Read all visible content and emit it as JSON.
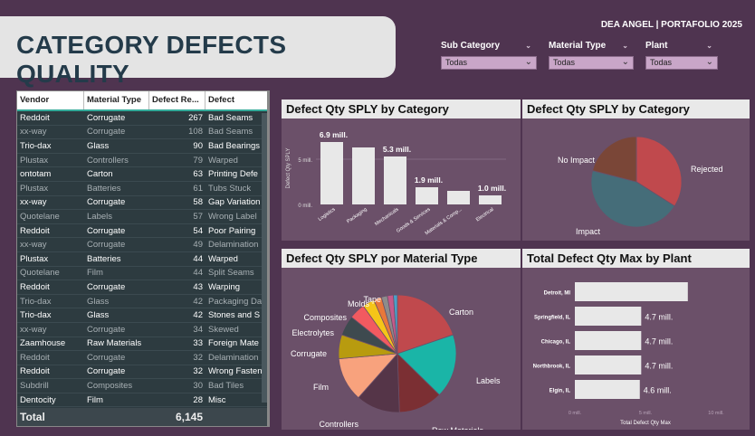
{
  "header": {
    "title": "CATEGORY DEFECTS QUALITY",
    "brand": "DEA ANGEL  |  PORTAFOLIO 2025"
  },
  "slicers": [
    {
      "label": "Sub Category",
      "value": "Todas"
    },
    {
      "label": "Material Type",
      "value": "Todas"
    },
    {
      "label": "Plant",
      "value": "Todas"
    }
  ],
  "table": {
    "columns": [
      "Vendor",
      "Material Type",
      "Defect Re...",
      "Defect"
    ],
    "rows": [
      {
        "vendor": "Reddoit",
        "material": "Corrugate",
        "qty": "267",
        "defect": "Bad Seams",
        "bright": true
      },
      {
        "vendor": "xx-way",
        "material": "Corrugate",
        "qty": "108",
        "defect": "Bad Seams",
        "bright": false
      },
      {
        "vendor": "Trio-dax",
        "material": "Glass",
        "qty": "90",
        "defect": "Bad Bearings",
        "bright": true
      },
      {
        "vendor": "Plustax",
        "material": "Controllers",
        "qty": "79",
        "defect": "Warped",
        "bright": false
      },
      {
        "vendor": "ontotam",
        "material": "Carton",
        "qty": "63",
        "defect": "Printing Defe",
        "bright": true
      },
      {
        "vendor": "Plustax",
        "material": "Batteries",
        "qty": "61",
        "defect": "Tubs Stuck",
        "bright": false
      },
      {
        "vendor": "xx-way",
        "material": "Corrugate",
        "qty": "58",
        "defect": "Gap Variation",
        "bright": true
      },
      {
        "vendor": "Quotelane",
        "material": "Labels",
        "qty": "57",
        "defect": "Wrong Label",
        "bright": false
      },
      {
        "vendor": "Reddoit",
        "material": "Corrugate",
        "qty": "54",
        "defect": "Poor Pairing",
        "bright": true
      },
      {
        "vendor": "xx-way",
        "material": "Corrugate",
        "qty": "49",
        "defect": "Delamination",
        "bright": false
      },
      {
        "vendor": "Plustax",
        "material": "Batteries",
        "qty": "44",
        "defect": "Warped",
        "bright": true
      },
      {
        "vendor": "Quotelane",
        "material": "Film",
        "qty": "44",
        "defect": "Split Seams",
        "bright": false
      },
      {
        "vendor": "Reddoit",
        "material": "Corrugate",
        "qty": "43",
        "defect": "Warping",
        "bright": true
      },
      {
        "vendor": "Trio-dax",
        "material": "Glass",
        "qty": "42",
        "defect": "Packaging Da",
        "bright": false
      },
      {
        "vendor": "Trio-dax",
        "material": "Glass",
        "qty": "42",
        "defect": "Stones and S",
        "bright": true
      },
      {
        "vendor": "xx-way",
        "material": "Corrugate",
        "qty": "34",
        "defect": "Skewed",
        "bright": false
      },
      {
        "vendor": "Zaamhouse",
        "material": "Raw Materials",
        "qty": "33",
        "defect": "Foreign Mate",
        "bright": true
      },
      {
        "vendor": "Reddoit",
        "material": "Corrugate",
        "qty": "32",
        "defect": "Delamination",
        "bright": false
      },
      {
        "vendor": "Reddoit",
        "material": "Corrugate",
        "qty": "32",
        "defect": "Wrong Fasten",
        "bright": true
      },
      {
        "vendor": "Subdrill",
        "material": "Composites",
        "qty": "30",
        "defect": "Bad Tiles",
        "bright": false
      },
      {
        "vendor": "Dentocity",
        "material": "Film",
        "qty": "28",
        "defect": "Misc",
        "bright": true
      }
    ],
    "total_label": "Total",
    "total_value": "6,145"
  },
  "panels": {
    "bar_title": "Defect Qty SPLY by Category",
    "pie1_title": "Defect Qty SPLY by Category",
    "pie2_title": "Defect Qty SPLY por Material Type",
    "hbar_title": "Total Defect Qty Max by Plant"
  },
  "chart_data": [
    {
      "type": "bar",
      "title": "Defect Qty SPLY by Category",
      "ylabel": "Defect Qty SPLY",
      "categories": [
        "Logistics",
        "Packaging",
        "Mechanicals",
        "Goods & Services",
        "Materials & Comp...",
        "Electrical"
      ],
      "values": [
        6.9,
        6.3,
        5.3,
        1.9,
        1.5,
        1.0
      ],
      "data_labels": [
        "6.9 mill.",
        "",
        "5.3 mill.",
        "1.9 mill.",
        "",
        "1.0 mill."
      ],
      "ytick_labels": [
        "0 mill.",
        "5 mill."
      ],
      "ylim": [
        0,
        8
      ],
      "color": "#e8e8e8"
    },
    {
      "type": "pie",
      "title": "Defect Qty SPLY by Category",
      "labels": [
        "Rejected",
        "Impact",
        "No Impact"
      ],
      "values": [
        34,
        45,
        21
      ],
      "colors": [
        "#c0494d",
        "#456d79",
        "#7a4637"
      ]
    },
    {
      "type": "pie",
      "title": "Defect Qty SPLY por Material Type",
      "labels": [
        "Carton",
        "Labels",
        "Raw Materials",
        "Controllers",
        "Film",
        "Corrugate",
        "Electrolytes",
        "Composites",
        "Molds",
        "Tape",
        "",
        "",
        ""
      ],
      "values": [
        18,
        16,
        11,
        11,
        11,
        6,
        5,
        4,
        3,
        2,
        1.5,
        1.5,
        1
      ],
      "colors": [
        "#c0494d",
        "#1ab5a7",
        "#7b2f33",
        "#553548",
        "#f8a27d",
        "#b89b0f",
        "#3e4a4f",
        "#f25a60",
        "#f5c518",
        "#e8783a",
        "#8c8c8c",
        "#c45a8a",
        "#4aa0c8"
      ]
    },
    {
      "type": "bar",
      "orientation": "horizontal",
      "title": "Total Defect Qty Max by Plant",
      "xlabel": "Total Defect Qty Max",
      "categories": [
        "Detroit, MI",
        "Springfield, IL",
        "Chicago, IL",
        "Northbrook, IL",
        "Elgin, IL"
      ],
      "values": [
        8.0,
        4.7,
        4.7,
        4.7,
        4.6
      ],
      "data_labels": [
        "",
        "4.7 mill.",
        "4.7 mill.",
        "4.7 mill.",
        "4.6 mill."
      ],
      "xtick_labels": [
        "0 mill.",
        "5 mill.",
        "10 mill."
      ],
      "xlim": [
        0,
        10
      ],
      "color": "#e8e8e8"
    }
  ]
}
